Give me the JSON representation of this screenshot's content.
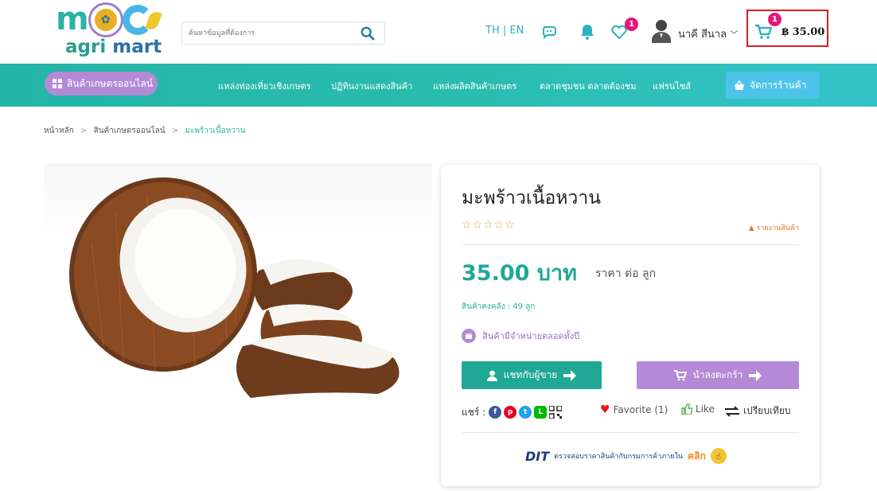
{
  "header": {
    "logo_text_agri": "agri",
    "logo_text_mart": "mart",
    "search_placeholder": "ค้นหาข้อมูลที่ต้องการ",
    "language": "TH | EN",
    "wishlist_badge": "1",
    "user_name": "นาคี สีนาล",
    "cart_badge": "1",
    "cart_amount": "฿ 35.00"
  },
  "nav": {
    "category_button": "สินค้าเกษตรออนไลน์",
    "links": [
      "แหล่งท่องเที่ยวเชิงเกษตร",
      "ปฏิทินงานแสดงสินค้า",
      "แหล่งผลิตสินค้าเกษตร",
      "ตลาดชุมชน ตลาดต้องชม",
      "แฟรนไชส์"
    ],
    "shop_button": "จัดการร้านค้า"
  },
  "breadcrumb": {
    "home": "หน้าหลัก",
    "category": "สินค้าเกษตรออนไลน์",
    "current": "มะพร้าวเนื้อหวาน",
    "separator": ">"
  },
  "product": {
    "title": "มะพร้าวเนื้อหวาน",
    "rating": 0,
    "rating_max": 5,
    "stars_text": "☆☆☆☆☆",
    "report_label": "รายงานสินค้า",
    "price": "35.00 บาท",
    "price_unit": "ราคา ต่อ ลูก",
    "stock": "สินค้าคงคลัง : 49 ลูก",
    "availability": "สินค้ามีจำหน่ายตลอดทั้งปี",
    "chat_button": "แชทกับผู้ขาย",
    "cart_button": "นำลงตะกร้า",
    "share_label": "แชร์ :",
    "favorite": "Favorite (1)",
    "like": "Like",
    "compare": "เปรียบเทียบ",
    "dit_logo": "DIT",
    "dit_text": "ตรวจสอบราคาสินค้ากับกรมการค้าภายใน",
    "dit_click": "คลิก"
  },
  "colors": {
    "brand_teal": "#23b5a6",
    "purple": "#b48ad6",
    "badge_pink": "#e6177a",
    "cart_highlight": "#e11b22"
  },
  "icons": {
    "search": "search-icon",
    "chat": "chat-bubbles-icon",
    "notifications": "bell-icon",
    "wishlist": "heart-outline-icon",
    "user": "user-avatar-icon",
    "cart": "cart-icon"
  }
}
